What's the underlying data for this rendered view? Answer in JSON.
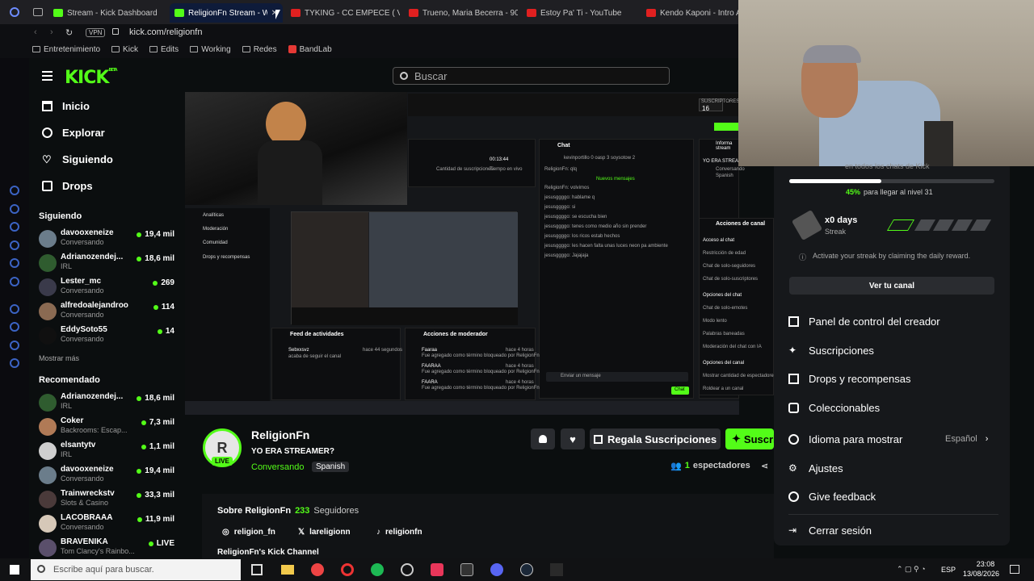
{
  "browser": {
    "tabs": [
      {
        "label": "Stream - Kick Dashboard"
      },
      {
        "label": "ReligionFn Stream - W"
      },
      {
        "label": "TYKING - CC EMPECE ( VI"
      },
      {
        "label": "Trueno, Maria Becerra - 90"
      },
      {
        "label": "Estoy Pa' Ti - YouTube"
      },
      {
        "label": "Kendo Kaponi - Intro Ap"
      }
    ],
    "vpn": "VPN",
    "url": "kick.com/religionfn",
    "bookmarks": [
      "Entretenimiento",
      "Kick",
      "Edits",
      "Working",
      "Redes",
      "BandLab"
    ]
  },
  "kick": {
    "logo": "KICK",
    "logo_beta": "BETA",
    "search_placeholder": "Buscar",
    "nav": [
      {
        "label": "Inicio"
      },
      {
        "label": "Explorar"
      },
      {
        "label": "Siguiendo"
      },
      {
        "label": "Drops"
      }
    ],
    "following_title": "Siguiendo",
    "following": [
      {
        "name": "davooxeneize",
        "category": "Conversando",
        "viewers": "19,4 mil"
      },
      {
        "name": "Adrianozendej...",
        "category": "IRL",
        "viewers": "18,6 mil"
      },
      {
        "name": "Lester_mc",
        "category": "Conversando",
        "viewers": "269"
      },
      {
        "name": "alfredoalejandroo",
        "category": "Conversando",
        "viewers": "114"
      },
      {
        "name": "EddySoto55",
        "category": "Conversando",
        "viewers": "14"
      }
    ],
    "show_more": "Mostrar más",
    "recommended_title": "Recomendado",
    "recommended": [
      {
        "name": "Adrianozendej...",
        "category": "IRL",
        "viewers": "18,6 mil"
      },
      {
        "name": "Coker",
        "category": "Backrooms: Escap...",
        "viewers": "7,3 mil"
      },
      {
        "name": "elsantytv",
        "category": "IRL",
        "viewers": "1,1 mil"
      },
      {
        "name": "davooxeneize",
        "category": "Conversando",
        "viewers": "19,4 mil"
      },
      {
        "name": "Trainwreckstv",
        "category": "Slots & Casino",
        "viewers": "33,3 mil"
      },
      {
        "name": "LACOBRAAA",
        "category": "Conversando",
        "viewers": "11,9 mil"
      },
      {
        "name": "BRAVENIKA",
        "category": "Tom Clancy's Rainbo...",
        "viewers": "LIVE"
      }
    ]
  },
  "stream_inner": {
    "chat_title": "Chat",
    "chat_users": "kevinportillo 0 oasp 3 soysotow 2",
    "new_messages": "Nuevos mensajes",
    "chat_lines": [
      "ReligionFn: qlq",
      "ReligionFn: volvimos",
      "jesusggggo: hablame q",
      "jesusggggo: si",
      "jesusggggo: se escucha bien",
      "jesusggggo: tenes como medio año sin prender",
      "jesusggggo: los ricos estab hechos",
      "jesusggggo: les hacen falta unas luces neon pa ambiente",
      "jesusggggo: Jajajaja"
    ],
    "send_placeholder": "Enviar un mensaje",
    "chat_button": "Chat",
    "nav_items": [
      "Analíticas",
      "Moderación",
      "Comunidad",
      "Drops y recompensas"
    ],
    "stat_time": "00:13:44",
    "stat_time_label": "Tiempo en vivo",
    "stat_subs_label": "Cantidad de suscripciones",
    "feed_title": "Feed de actividades",
    "feed_user": "Sebxxsvz",
    "feed_text": "acaba de seguir el canal",
    "feed_time": "hace 44 segundos",
    "mod_title": "Acciones de moderador",
    "mod_entries": [
      {
        "user": "Faaraa",
        "time": "hace 4 horas",
        "text": "Fue agregado como término bloqueado por ReligionFn"
      },
      {
        "user": "FAARAA",
        "time": "hace 4 horas",
        "text": "Fue agregado como término bloqueado por ReligionFn"
      },
      {
        "user": "FAARA",
        "time": "hace 4 horas",
        "text": "Fue agregado como término bloqueado por ReligionFn"
      }
    ],
    "right_title": "Informa stream",
    "right_sub": "YO ERA STREAMER?",
    "right_cat": "Conversando",
    "right_lang": "Spanish",
    "channel_actions_title": "Acciones de canal",
    "channel_actions": [
      "Acceso al chat",
      "Restricción de edad",
      "Chat de solo-seguidores",
      "Chat de solo-suscriptores",
      "Opciones del chat",
      "Chat de solo-emotes",
      "Modo lento",
      "Palabras baneadas",
      "Moderación del chat con IA",
      "Opciones del canal",
      "Mostrar cantidad de espectadores",
      "Roldear a un canal"
    ],
    "top_subs_label": "SUSCRIPTORES",
    "top_subs_value": "16"
  },
  "channel": {
    "avatar_letter": "R",
    "live": "LIVE",
    "name": "ReligionFn",
    "title": "YO ERA STREAMER?",
    "category": "Conversando",
    "language": "Spanish",
    "gift_subs": "Regala Suscripciones",
    "subscribe": "Suscri",
    "viewers_count": "1",
    "viewers_label": "espectadores",
    "about_title": "Sobre ReligionFn",
    "followers_count": "233",
    "followers_label": "Seguidores",
    "socials": [
      {
        "label": "religion_fn"
      },
      {
        "label": "lareligionn"
      },
      {
        "label": "religionfn"
      }
    ],
    "channel_label": "ReligionFn's Kick Channel"
  },
  "menu": {
    "top_text": "en todos los chats de Kick",
    "level_progress": 0.45,
    "level_percent": "45%",
    "level_text": "para llegar al nivel 31",
    "streak_days": "x0 days",
    "streak_label": "Streak",
    "streak_info": "Activate your streak by claiming the daily reward.",
    "view_channel": "Ver tu canal",
    "items": [
      {
        "label": "Panel de control del creador"
      },
      {
        "label": "Suscripciones"
      },
      {
        "label": "Drops y recompensas"
      },
      {
        "label": "Coleccionables"
      },
      {
        "label": "Idioma para mostrar"
      },
      {
        "label": "Ajustes"
      },
      {
        "label": "Give feedback"
      },
      {
        "label": "Cerrar sesión"
      }
    ],
    "language_value": "Español"
  },
  "taskbar": {
    "search_placeholder": "Escribe aquí para buscar.",
    "lang": "ESP",
    "time": "23:08",
    "date": "13/08/2026"
  },
  "colors": {
    "kick_green": "#53fc18",
    "accent_blue": "#3b63c4",
    "menu_bg": "#16181b"
  }
}
